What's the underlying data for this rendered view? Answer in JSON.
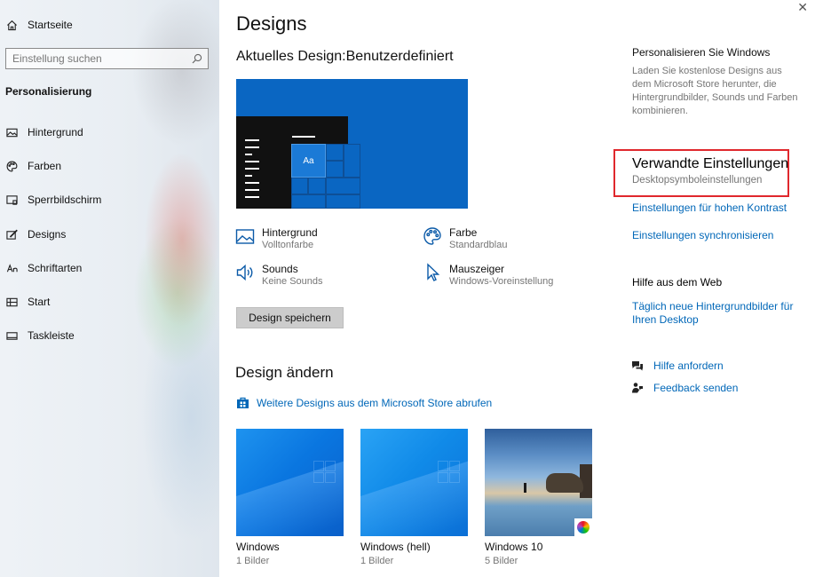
{
  "sidebar": {
    "home_label": "Startseite",
    "search_placeholder": "Einstellung suchen",
    "section_title": "Personalisierung",
    "items": [
      {
        "label": "Hintergrund",
        "icon": "picture-icon"
      },
      {
        "label": "Farben",
        "icon": "palette-icon"
      },
      {
        "label": "Sperrbildschirm",
        "icon": "lockscreen-icon"
      },
      {
        "label": "Designs",
        "icon": "brush-icon"
      },
      {
        "label": "Schriftarten",
        "icon": "font-icon"
      },
      {
        "label": "Start",
        "icon": "start-icon"
      },
      {
        "label": "Taskleiste",
        "icon": "taskbar-icon"
      }
    ]
  },
  "main": {
    "title": "Designs",
    "current_design_label": "Aktuelles Design:",
    "current_design_value": "Benutzerdefiniert",
    "preview_tile_text": "Aa",
    "options": [
      {
        "title": "Hintergrund",
        "value": "Volltonfarbe",
        "icon": "picture-icon"
      },
      {
        "title": "Farbe",
        "value": "Standardblau",
        "icon": "palette-icon"
      },
      {
        "title": "Sounds",
        "value": "Keine Sounds",
        "icon": "speaker-icon"
      },
      {
        "title": "Mauszeiger",
        "value": "Windows-Voreinstellung",
        "icon": "cursor-icon"
      }
    ],
    "save_button": "Design speichern",
    "change_title": "Design ändern",
    "store_link": "Weitere Designs aus dem Microsoft Store abrufen",
    "themes": [
      {
        "name": "Windows",
        "count": "1 Bilder"
      },
      {
        "name": "Windows (hell)",
        "count": "1 Bilder"
      },
      {
        "name": "Windows 10",
        "count": "5 Bilder"
      }
    ]
  },
  "right": {
    "personalize_title": "Personalisieren Sie Windows",
    "personalize_text": "Laden Sie kostenlose Designs aus dem Microsoft Store herunter, die Hintergrundbilder, Sounds und Farben kombinieren.",
    "related_title": "Verwandte Einstellungen",
    "desktop_icons_link": "Desktopsymboleinstellungen",
    "contrast_link": "Einstellungen für hohen Kontrast",
    "sync_link": "Einstellungen synchronisieren",
    "web_help_title": "Hilfe aus dem Web",
    "daily_wallpaper_link": "Täglich neue Hintergrundbilder für Ihren Desktop",
    "get_help": "Hilfe anfordern",
    "feedback": "Feedback senden"
  },
  "colors": {
    "accent": "#0067b8",
    "highlight_border": "#e0282d",
    "preview_blue": "#0a66c2"
  }
}
